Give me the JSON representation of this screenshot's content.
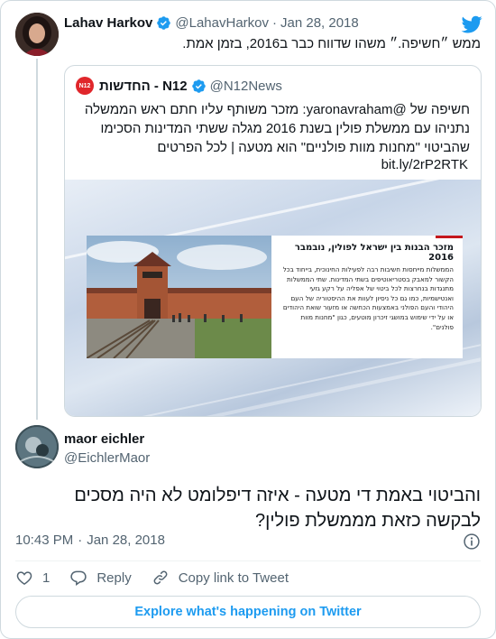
{
  "parent_tweet": {
    "display_name": "Lahav Harkov",
    "handle": "@LahavHarkov",
    "separator": "·",
    "date": "Jan 28, 2018",
    "text": "ממש ״חשיפה.״ משהו שדווח כבר ב2016, בזמן אמת."
  },
  "quoted_tweet": {
    "display_name": "החדשות - N12",
    "handle": "@N12News",
    "logo_text": "N12",
    "text": "חשיפה של @yaronavraham: מזכר משותף עליו חתם ראש הממשלה נתניהו עם ממשלת פולין בשנת 2016 מגלה ששתי המדינות הסכימו שהביטוי \"מחנות מוות פולניים\" הוא מטעה | לכל הפרטים",
    "link": "bit.ly/2rP2RTK",
    "media": {
      "memo_title": "מזכר הבנות בין ישראל לפולין, נובמבר 2016",
      "memo_body": "הממשלות מייחסות חשיבות רבה לפעילות החינוכית, בייחוד בכל הקשור למאבק בסטריאוטיפים בשתי המדינות. שתי הממשלות מתנגדות בנחרצות לכל ביטוי של אפליה על רקע גזעי ואנטישמיות, כמו גם כל ניסיון לעוות את ההיסטוריה של העם היהודי והעם הפולני באמצעות הכחשה או מזעור שואת היהודים או על ידי שימוש במושגי זיכרון מוטעים, כגון \"מחנות מוות פולנים\"."
    }
  },
  "reply_tweet": {
    "display_name": "maor eichler",
    "handle": "@EichlerMaor",
    "text": "והביטוי באמת די מטעה - איזה דיפלומט לא היה מסכים לבקשה כזאת מממשלת פולין?",
    "time": "10:43 PM",
    "separator": "·",
    "date": "Jan 28, 2018"
  },
  "actions": {
    "like_count": "1",
    "reply_label": "Reply",
    "copy_link_label": "Copy link to Tweet"
  },
  "explore_label": "Explore what's happening on Twitter",
  "colors": {
    "twitter_blue": "#1d9bf0",
    "n12_red": "#e0262b",
    "muted_text": "#536471",
    "border": "#cfd9de"
  },
  "icons": [
    "verified-badge-icon",
    "twitter-bird-icon",
    "info-icon",
    "heart-icon",
    "reply-bubble-icon",
    "link-icon"
  ]
}
